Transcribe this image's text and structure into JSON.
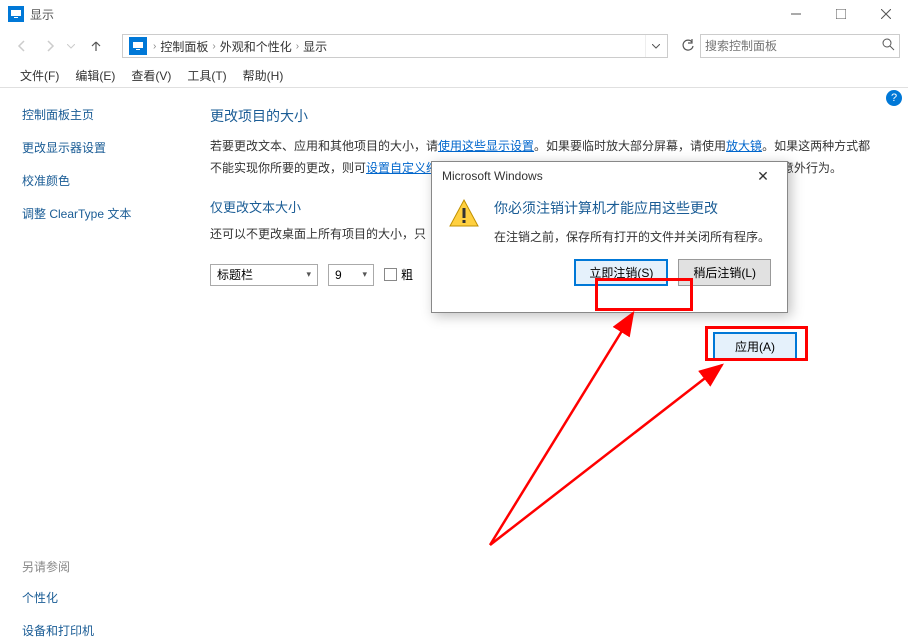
{
  "titlebar": {
    "title": "显示"
  },
  "address": {
    "items": [
      "控制面板",
      "外观和个性化",
      "显示"
    ]
  },
  "search": {
    "placeholder": "搜索控制面板"
  },
  "menu": {
    "file": "文件(F)",
    "edit": "编辑(E)",
    "view": "查看(V)",
    "tools": "工具(T)",
    "help": "帮助(H)"
  },
  "sidebar": {
    "home": "控制面板主页",
    "links": [
      "更改显示器设置",
      "校准颜色",
      "调整 ClearType 文本"
    ],
    "footer_title": "另请参阅",
    "footer_links": [
      "个性化",
      "设备和打印机"
    ]
  },
  "main": {
    "heading1": "更改项目的大小",
    "para1_prefix": "若要更改文本、应用和其他项目的大小，请",
    "para1_link1": "使用这些显示设置",
    "para1_mid": "。如果要临时放大部分屏幕，请使用",
    "para1_link2": "放大镜",
    "para1_mid2": "。如果这两种方式都不能实现你所要的更改，则可",
    "para1_link3": "设置自定义缩放级别",
    "para1_suffix": "(不建议)。设置自定义级别可能会导致在某些显示器上出现意外行为。",
    "heading2": "仅更改文本大小",
    "para2": "还可以不更改桌面上所有项目的大小，只",
    "select_title": "标题栏",
    "select_size": "9",
    "bold_label": "粗",
    "apply_label": "应用(A)"
  },
  "dialog": {
    "title": "Microsoft Windows",
    "heading": "你必须注销计算机才能应用这些更改",
    "text": "在注销之前，保存所有打开的文件并关闭所有程序。",
    "btn_now": "立即注销(S)",
    "btn_later": "稍后注销(L)"
  }
}
